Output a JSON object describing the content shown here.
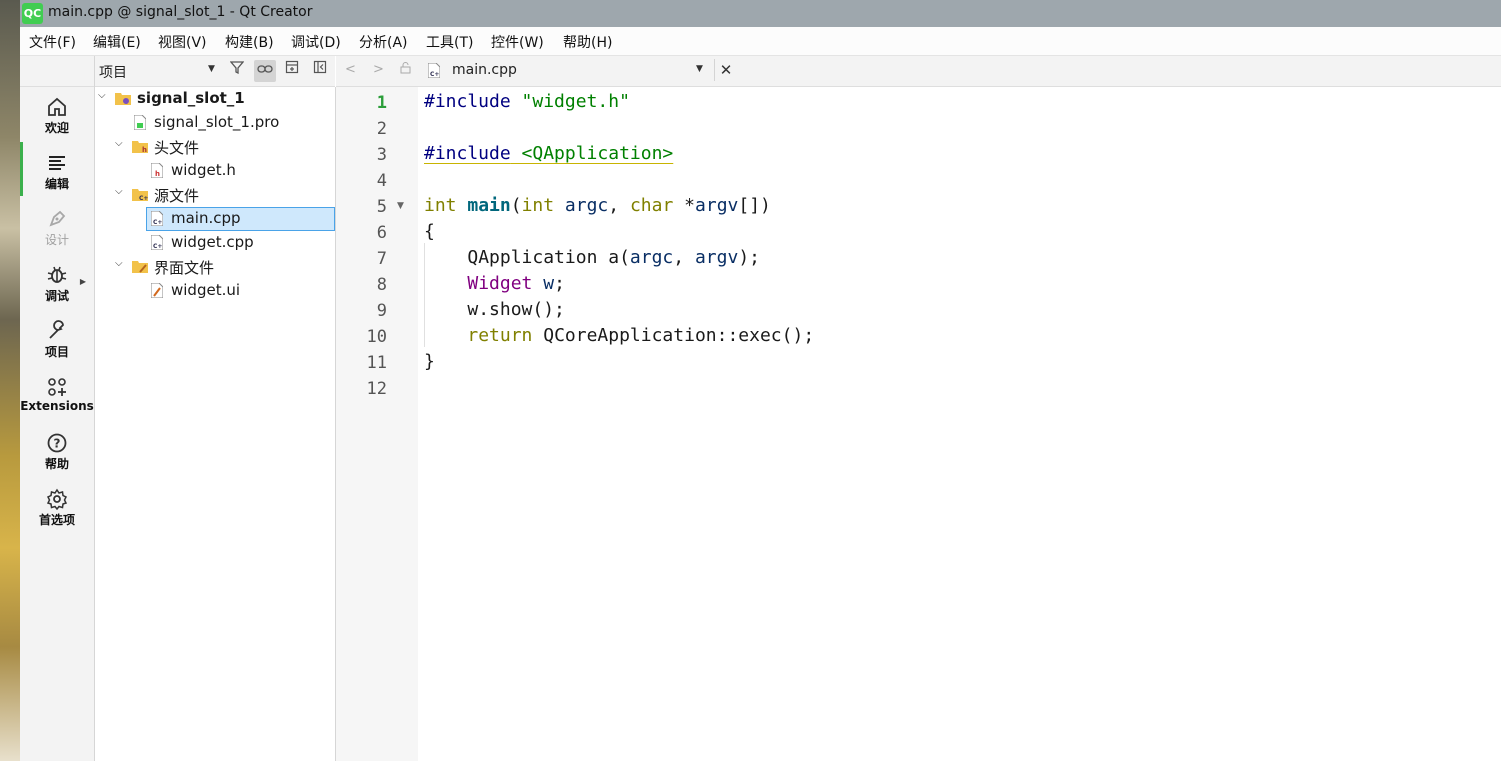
{
  "window": {
    "title": "main.cpp @ signal_slot_1 - Qt Creator",
    "logo_text": "QC"
  },
  "menu": [
    "文件(F)",
    "编辑(E)",
    "视图(V)",
    "构建(B)",
    "调试(D)",
    "分析(A)",
    "工具(T)",
    "控件(W)",
    "帮助(H)"
  ],
  "modes": [
    {
      "label": "欢迎",
      "icon": "home-icon"
    },
    {
      "label": "编辑",
      "icon": "edit-lines-icon",
      "active": true
    },
    {
      "label": "设计",
      "icon": "pen-icon",
      "disabled": true
    },
    {
      "label": "调试",
      "icon": "bug-icon"
    },
    {
      "label": "项目",
      "icon": "wrench-icon"
    },
    {
      "label": "Extensions",
      "icon": "extensions-icon"
    },
    {
      "label": "帮助",
      "icon": "help-icon"
    },
    {
      "label": "首选项",
      "icon": "gear-icon"
    }
  ],
  "project_panel": {
    "view_label": "项目",
    "tree": [
      {
        "label": "signal_slot_1",
        "type": "project",
        "expanded": true
      },
      {
        "label": "signal_slot_1.pro",
        "type": "pro-file"
      },
      {
        "label": "头文件",
        "type": "folder-headers",
        "expanded": true
      },
      {
        "label": "widget.h",
        "type": "header-file"
      },
      {
        "label": "源文件",
        "type": "folder-sources",
        "expanded": true
      },
      {
        "label": "main.cpp",
        "type": "cpp-file",
        "selected": true
      },
      {
        "label": "widget.cpp",
        "type": "cpp-file"
      },
      {
        "label": "界面文件",
        "type": "folder-forms",
        "expanded": true
      },
      {
        "label": "widget.ui",
        "type": "ui-file"
      }
    ]
  },
  "editor": {
    "document": "main.cpp",
    "current_line": 1,
    "line_numbers": [
      "1",
      "2",
      "3",
      "4",
      "5",
      "6",
      "7",
      "8",
      "9",
      "10",
      "11",
      "12"
    ],
    "code": {
      "l1_pre": "#include ",
      "l1_str": "\"widget.h\"",
      "l3_pre": "#include",
      "l3_inc": " <QApplication>",
      "l5_kw1": "int",
      "l5_fn": "main",
      "l5_p1": "(",
      "l5_kw2": "int",
      "l5_v1": "argc",
      "l5_p2": ", ",
      "l5_kw3": "char",
      "l5_p3": " *",
      "l5_v2": "argv",
      "l5_p4": "[])",
      "l6": "{",
      "l7_a": "QApplication a",
      "l7_p1": "(",
      "l7_v1": "argc",
      "l7_p2": ", ",
      "l7_v2": "argv",
      "l7_p3": ");",
      "l8_type": "Widget",
      "l8_var": "w",
      "l8_end": ";",
      "l9": "w.show();",
      "l10_kw": "return",
      "l10_rest": " QCoreApplication::exec();",
      "l11": "}"
    }
  },
  "colors": {
    "accent_green": "#3bb04c",
    "selection": "#cfe8fc",
    "keyword": "#808000",
    "string": "#008000",
    "preprocessor": "#000080",
    "type": "#800080"
  }
}
